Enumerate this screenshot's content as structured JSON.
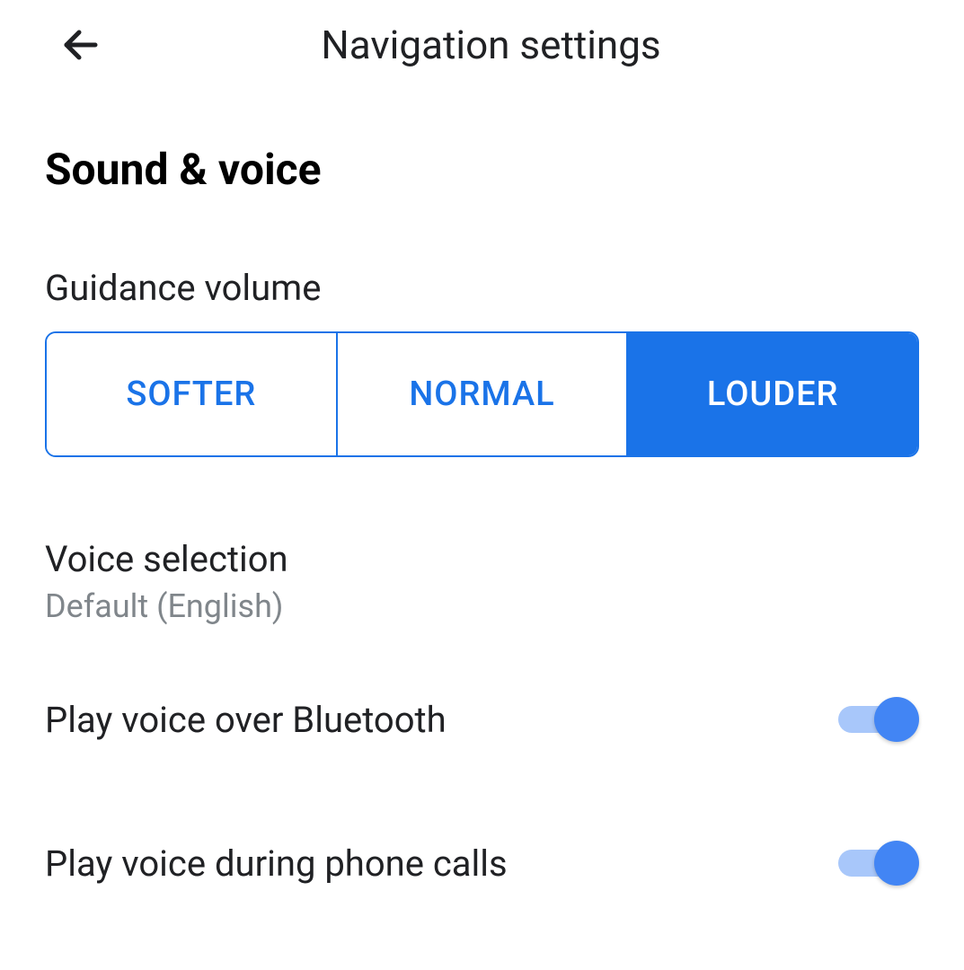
{
  "header": {
    "title": "Navigation settings"
  },
  "section": {
    "title": "Sound & voice"
  },
  "guidance_volume": {
    "label": "Guidance volume",
    "options": {
      "softer": "SOFTER",
      "normal": "NORMAL",
      "louder": "LOUDER"
    },
    "selected": "louder"
  },
  "voice_selection": {
    "title": "Voice selection",
    "value": "Default (English)"
  },
  "toggles": {
    "bluetooth": {
      "label": "Play voice over Bluetooth",
      "enabled": true
    },
    "phone_calls": {
      "label": "Play voice during phone calls",
      "enabled": true
    }
  }
}
